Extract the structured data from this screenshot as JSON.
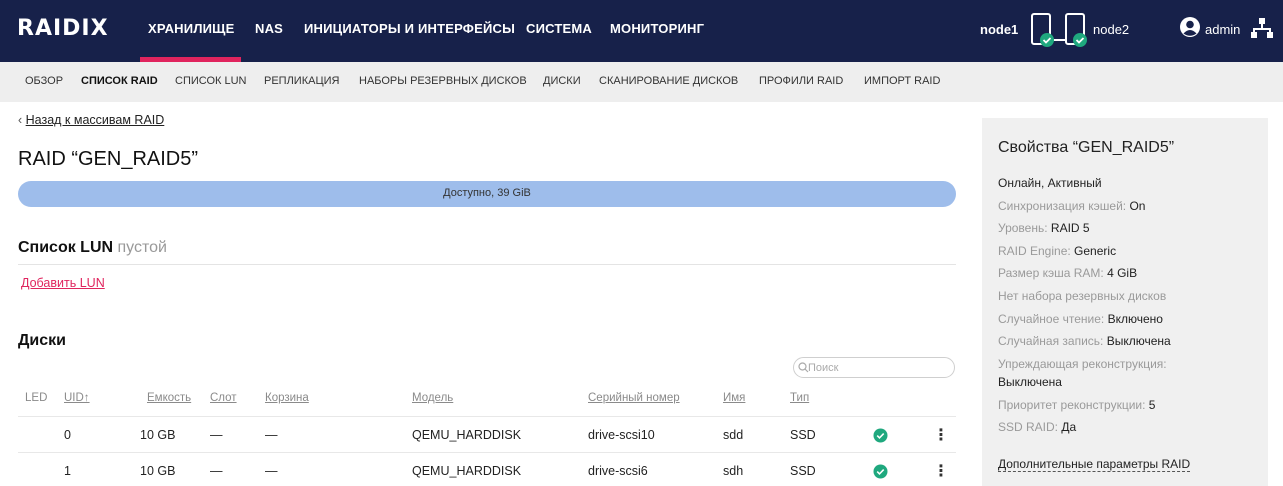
{
  "brand": {
    "logo": "RAIDIX",
    "accent": "#e0245e",
    "nav_bg": "#17214a"
  },
  "topnav": {
    "items": [
      "ХРАНИЛИЩЕ",
      "NAS",
      "ИНИЦИАТОРЫ И ИНТЕРФЕЙСЫ",
      "СИСТЕМА",
      "МОНИТОРИНГ"
    ],
    "active": "ХРАНИЛИЩЕ"
  },
  "nodes": {
    "node1": "node1",
    "node2": "node2",
    "status_icon": "check-icon"
  },
  "user": {
    "name": "admin"
  },
  "subnav": {
    "items": [
      "ОБЗОР",
      "СПИСОК RAID",
      "СПИСОК LUN",
      "РЕПЛИКАЦИЯ",
      "НАБОРЫ РЕЗЕРВНЫХ ДИСКОВ",
      "ДИСКИ",
      "СКАНИРОВАНИЕ ДИСКОВ",
      "ПРОФИЛИ RAID",
      "ИМПОРТ RAID"
    ],
    "active": "СПИСОК RAID"
  },
  "main": {
    "back_link": "Назад к массивам RAID",
    "title": "RAID “GEN_RAID5”",
    "capacity_label": "Доступно, 39 GiB",
    "capacity_available_fraction": 1.0,
    "lun_section": {
      "title": "Список LUN",
      "empty_label": "пустой",
      "add_label": "Добавить LUN"
    },
    "disks_section": {
      "title": "Диски",
      "search_placeholder": "Поиск"
    }
  },
  "disks_table": {
    "headers": {
      "led": "LED",
      "uid": "UID↑",
      "capacity": "Емкость",
      "slot": "Слот",
      "enclosure": "Корзина",
      "model": "Модель",
      "serial": "Серийный номер",
      "name": "Имя",
      "type": "Тип"
    },
    "rows": [
      {
        "uid": "0",
        "capacity": "10 GB",
        "slot": "—",
        "enclosure": "—",
        "model": "QEMU_HARDDISK",
        "serial": "drive-scsi10",
        "name": "sdd",
        "type": "SSD",
        "status": "ok"
      },
      {
        "uid": "1",
        "capacity": "10 GB",
        "slot": "—",
        "enclosure": "—",
        "model": "QEMU_HARDDISK",
        "serial": "drive-scsi6",
        "name": "sdh",
        "type": "SSD",
        "status": "ok"
      }
    ]
  },
  "properties": {
    "title": "Свойства “GEN_RAID5”",
    "state": "Онлайн, Активный",
    "items": [
      {
        "label": "Синхронизация кэшей:",
        "value": "On"
      },
      {
        "label": "Уровень:",
        "value": "RAID 5"
      },
      {
        "label": "RAID Engine:",
        "value": "Generic"
      },
      {
        "label": "Размер кэша RAM:",
        "value": "4 GiB"
      },
      {
        "label": "Нет набора резервных дисков",
        "value": ""
      },
      {
        "label": "Случайное чтение:",
        "value": "Включено"
      },
      {
        "label": "Случайная запись:",
        "value": "Выключена"
      },
      {
        "label": "Упреждающая реконструкция:",
        "value": "Выключена"
      },
      {
        "label": "Приоритет реконструкции:",
        "value": "5"
      },
      {
        "label": "SSD RAID:",
        "value": "Да"
      }
    ],
    "more_link": "Дополнительные параметры RAID"
  }
}
